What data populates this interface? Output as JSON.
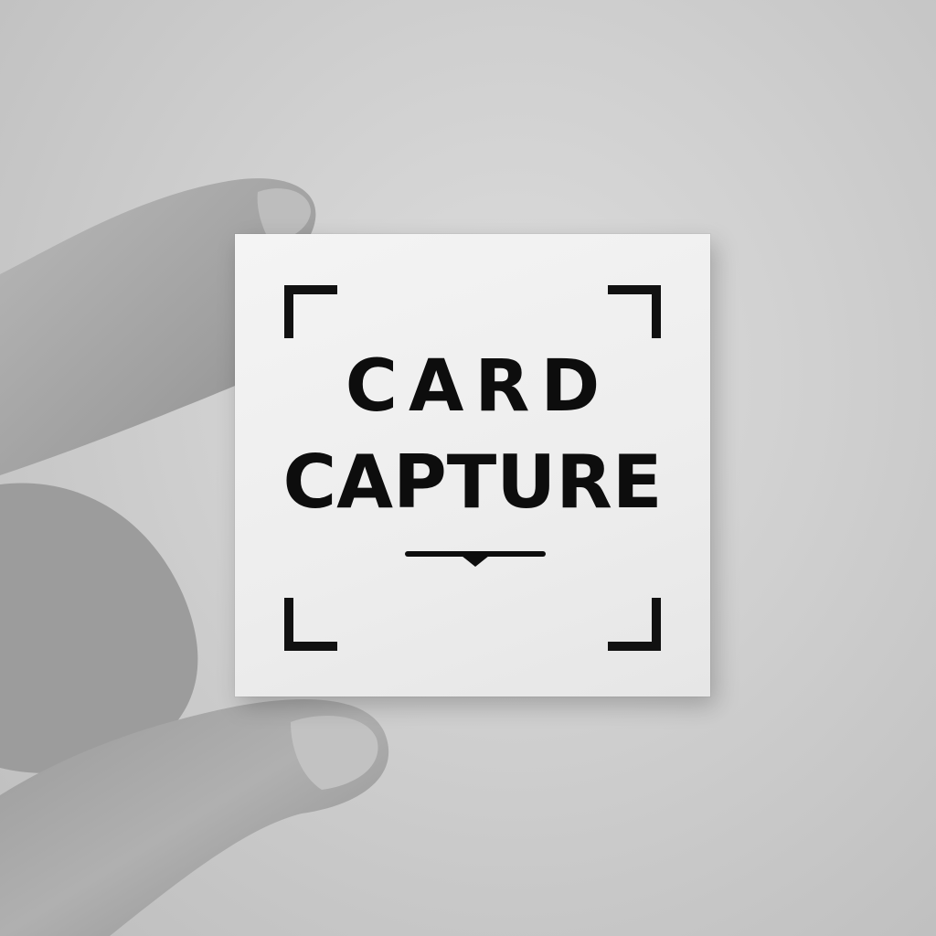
{
  "card": {
    "title_line1": "CARD",
    "title_line2": "CAPTURE"
  },
  "colors": {
    "background": "#cfcfcf",
    "card": "#efefef",
    "ink": "#0d0d0d",
    "skin": "#a9a9a9"
  }
}
